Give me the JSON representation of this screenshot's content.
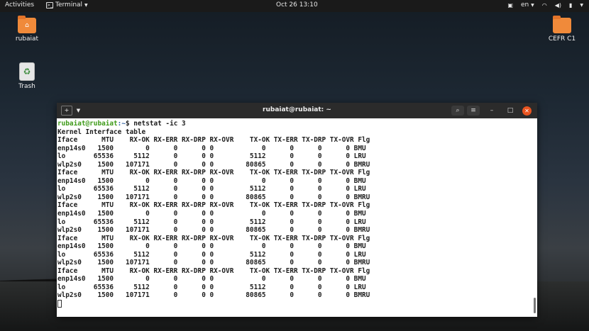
{
  "topbar": {
    "activities": "Activities",
    "app_name": "Terminal",
    "clock": "Oct 26  13:10",
    "language": "en"
  },
  "desktop": {
    "icons": [
      {
        "label": "rubaiat"
      },
      {
        "label": "Trash"
      },
      {
        "label": "CEFR C1"
      }
    ]
  },
  "terminal": {
    "title": "rubaiat@rubaiat: ~",
    "prompt_user": "rubaiat@rubaiat",
    "prompt_path": ":~",
    "prompt_symbol": "$",
    "command": " netstat -ic 3",
    "heading": "Kernel Interface table",
    "header_line": "Iface      MTU    RX-OK RX-ERR RX-DRP RX-OVR    TX-OK TX-ERR TX-DRP TX-OVR Flg",
    "rows": [
      "enp14s0   1500        0      0      0 0            0      0      0      0 BMU",
      "lo       65536     5112      0      0 0         5112      0      0      0 LRU",
      "wlp2s0    1500   107171      0      0 0        80865      0      0      0 BMRU"
    ],
    "repeat_count": 5
  },
  "colors": {
    "prompt_user": "#3f9b1a",
    "prompt_path": "#3465a4",
    "close_button": "#e95420",
    "folder": "#f08a3a"
  }
}
